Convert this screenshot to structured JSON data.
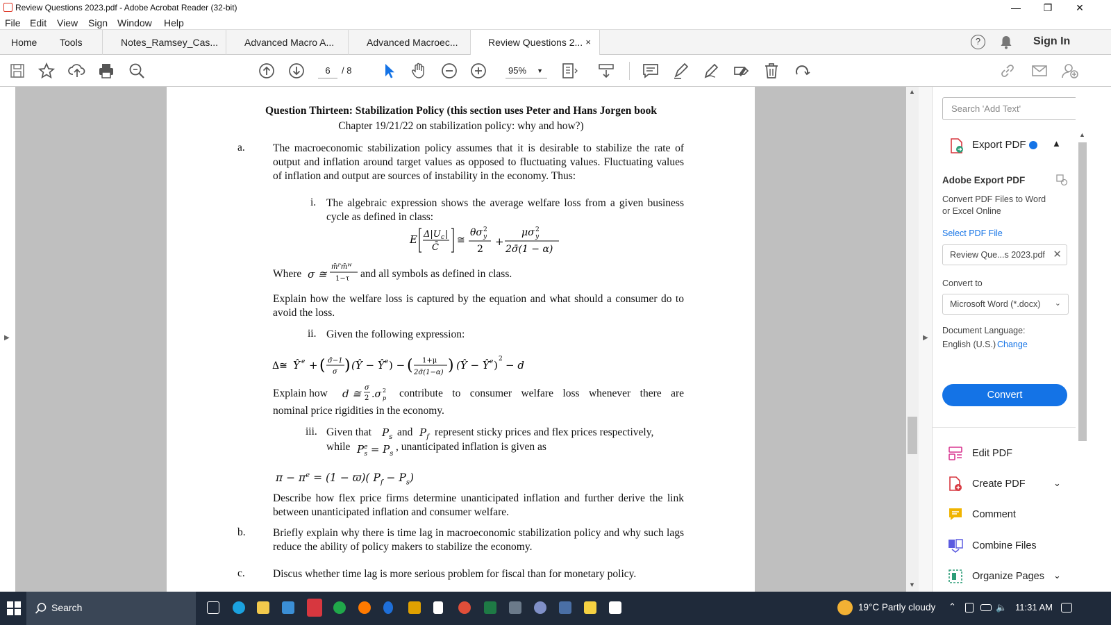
{
  "window": {
    "title": "Review Questions 2023.pdf - Adobe Acrobat Reader (32-bit)",
    "minimize": "—",
    "restore": "❐",
    "close": "✕"
  },
  "menu": [
    "File",
    "Edit",
    "View",
    "Sign",
    "Window",
    "Help"
  ],
  "tabs": {
    "home": "Home",
    "tools": "Tools",
    "doc1": "Notes_Ramsey_Cas...",
    "doc2": "Advanced Macro A...",
    "doc3": "Advanced Macroec...",
    "doc4": "Review Questions 2...",
    "close": "×",
    "help": "?",
    "sign_in": "Sign In"
  },
  "toolbar": {
    "page_current": "6",
    "page_total": "/ 8",
    "zoom": "95%"
  },
  "document": {
    "heading_line1": "Question Thirteen: Stabilization Policy (this section uses Peter and Hans Jorgen book",
    "heading_line2": "Chapter 19/21/22 on stabilization policy: why and how?)",
    "a_label": "a.",
    "a_text": "The macroeconomic stabilization policy assumes that it is desirable to stabilize the rate of output and inflation around target values as opposed to fluctuating values. Fluctuating values of inflation and output are sources of instability in the economy. Thus:",
    "i_label": "i.",
    "i_text": "The algebraic expression shows the average welfare loss from a given business cycle as defined in class:",
    "where_text": "and all symbols as defined in class.",
    "explain1": "Explain how the welfare loss is captured by the equation and what should a consumer do to avoid the loss.",
    "ii_label": "ii.",
    "ii_text": "Given the following expression:",
    "explain2_a": "Explain how",
    "explain2_b": "contribute to consumer welfare loss whenever there are",
    "explain2_c": "nominal price rigidities in the economy.",
    "iii_label": "iii.",
    "iii_text_a": "Given that",
    "iii_text_b": "and",
    "iii_text_c": "represent sticky prices and flex prices respectively,",
    "iii_text_d": "while",
    "iii_text_e": ", unanticipated inflation is given as",
    "describe": "Describe how flex price firms determine unanticipated inflation and further derive the link between unanticipated inflation and consumer welfare.",
    "b_label": "b.",
    "b_text": "Briefly explain why there is time lag in macroeconomic stabilization policy and why such lags reduce the ability of policy makers to stabilize the economy.",
    "c_label": "c.",
    "c_text": "Discus whether time lag is more serious problem for fiscal than for monetary policy."
  },
  "right_panel": {
    "search_placeholder": "Search 'Add Text'",
    "export_pdf": "Export PDF",
    "adobe_export_pdf": "Adobe Export PDF",
    "convert_desc": "Convert PDF Files to Word or Excel Online",
    "select_pdf_file": "Select PDF File",
    "file_name": "Review Que...s 2023.pdf",
    "convert_to": "Convert to",
    "format": "Microsoft Word (*.docx)",
    "doc_language_label": "Document Language:",
    "doc_language": "English (U.S.)",
    "change": "Change",
    "convert_button": "Convert",
    "tools": [
      "Edit PDF",
      "Create PDF",
      "Comment",
      "Combine Files",
      "Organize Pages"
    ]
  },
  "taskbar": {
    "search": "Search",
    "weather": "19°C  Partly cloudy",
    "time": "11:31 AM"
  },
  "colors": {
    "accent": "#1473e6",
    "pdf_red": "#d7373f",
    "taskbar": "#1f2a3a"
  }
}
